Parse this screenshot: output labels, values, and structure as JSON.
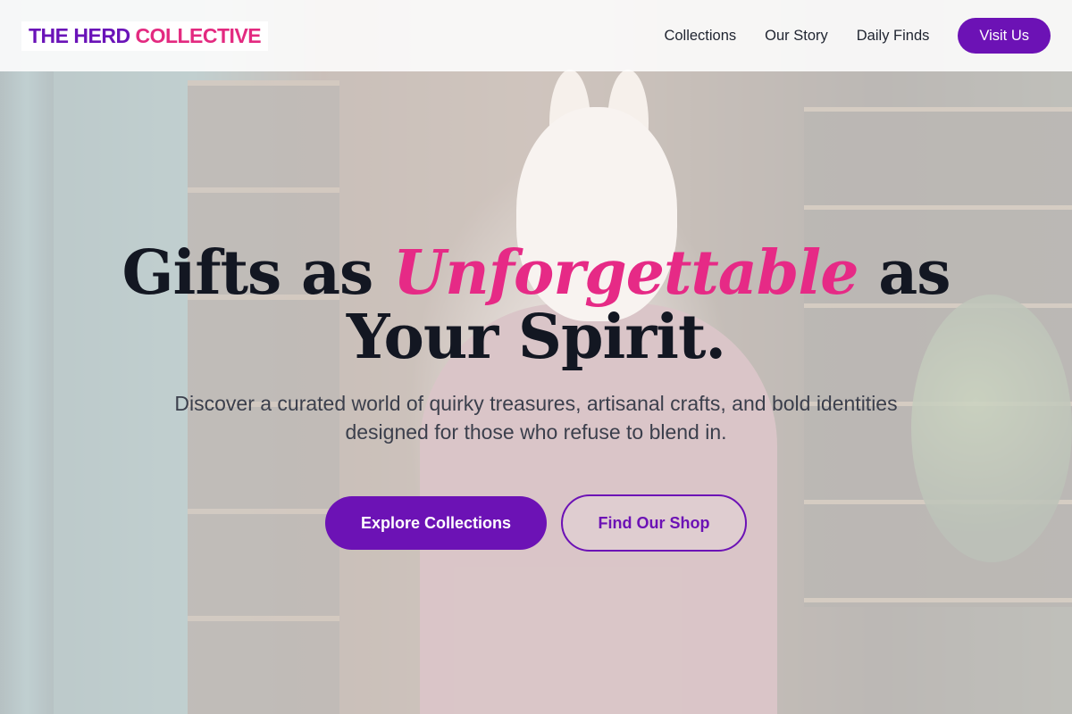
{
  "brand": {
    "part1": "THE HERD",
    "part2": "COLLECTIVE"
  },
  "nav": {
    "items": [
      {
        "label": "Collections"
      },
      {
        "label": "Our Story"
      },
      {
        "label": "Daily Finds"
      }
    ],
    "cta_label": "Visit Us"
  },
  "hero": {
    "headline_before": "Gifts as",
    "headline_accent": "Unforgettable",
    "headline_after": "as",
    "headline_line2": "Your Spirit.",
    "subtitle": "Discover a curated world of quirky treasures, artisanal crafts, and bold identities designed for those who refuse to blend in.",
    "primary_cta": "Explore Collections",
    "secondary_cta": "Find Our Shop"
  },
  "colors": {
    "brand_purple": "#6c12b5",
    "accent_pink": "#e62a86",
    "heading_dark": "#131722"
  }
}
